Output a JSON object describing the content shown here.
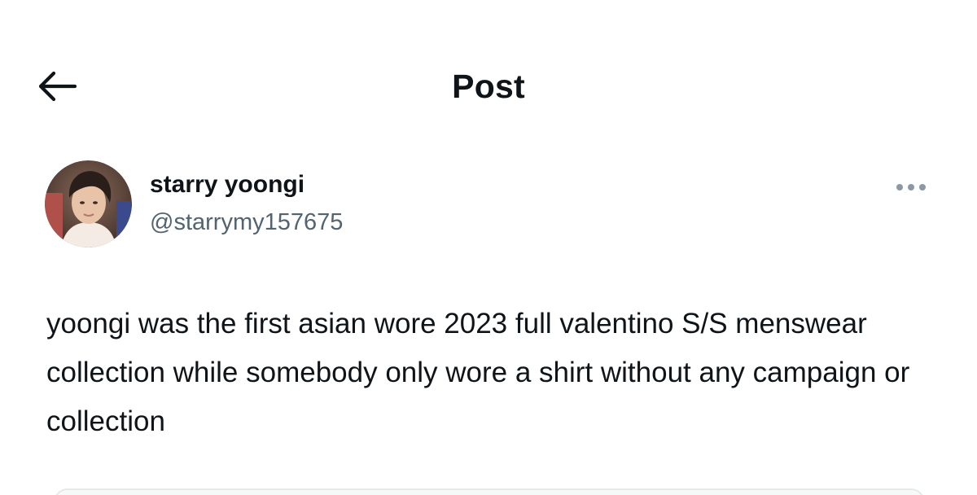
{
  "header": {
    "title": "Post",
    "back_icon": "arrow-left-icon"
  },
  "post": {
    "author": {
      "display_name": "starry yoongi",
      "handle": "@starrymy157675",
      "avatar_icon": "user-avatar"
    },
    "more_icon": "more-horizontal-icon",
    "text": "yoongi was the first asian wore 2023 full valentino S/S menswear collection while somebody only wore a shirt without any campaign or collection"
  },
  "colors": {
    "text_primary": "#0f1419",
    "text_secondary": "#536471",
    "icon_muted": "#8b98a5",
    "background": "#ffffff"
  }
}
